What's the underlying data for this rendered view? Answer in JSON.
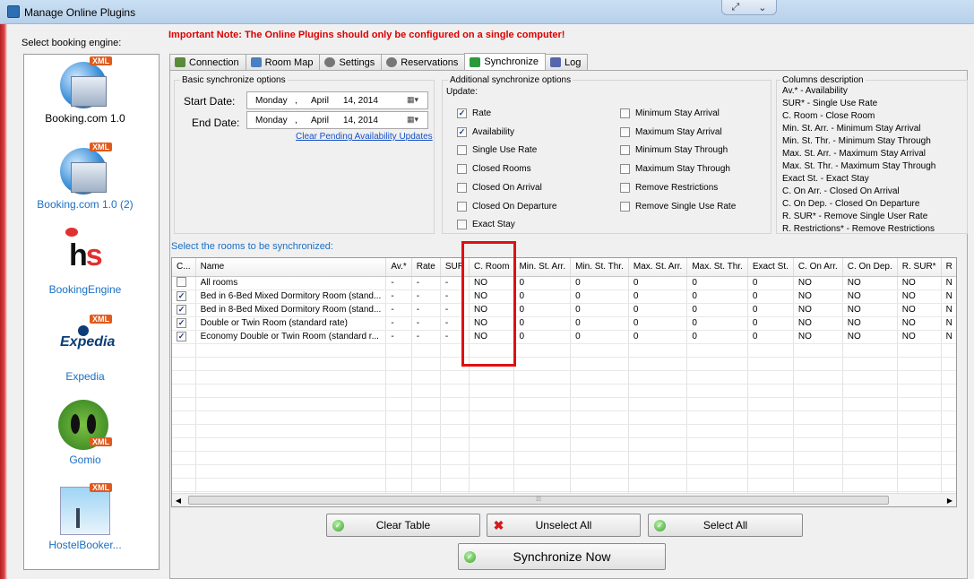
{
  "window": {
    "title": "Manage Online Plugins"
  },
  "left": {
    "select_label": "Select booking engine:",
    "engines": [
      {
        "label": "Booking.com 1.0",
        "icon": "booking-xml-icon",
        "selected": true
      },
      {
        "label": "Booking.com 1.0 (2)",
        "icon": "booking-xml-icon",
        "selected": false
      },
      {
        "label": "BookingEngine",
        "icon": "hs-logo",
        "selected": false
      },
      {
        "label": "Expedia",
        "icon": "expedia-logo",
        "selected": false
      },
      {
        "label": "Gomio",
        "icon": "gomio-logo",
        "selected": false
      },
      {
        "label": "HostelBooker...",
        "icon": "hostelbooker-logo",
        "selected": false
      }
    ],
    "xml_badge": "XML"
  },
  "note": "Important Note: The Online Plugins should only be configured on a single computer!",
  "tabs": [
    {
      "label": "Connection",
      "icon": "connection-icon"
    },
    {
      "label": "Room Map",
      "icon": "room-map-icon"
    },
    {
      "label": "Settings",
      "icon": "gear-icon"
    },
    {
      "label": "Reservations",
      "icon": "gear-icon"
    },
    {
      "label": "Synchronize",
      "icon": "sync-icon",
      "active": true
    },
    {
      "label": "Log",
      "icon": "log-icon"
    }
  ],
  "basic": {
    "title": "Basic synchronize options",
    "start_label": "Start Date:",
    "end_label": "End Date:",
    "start": {
      "weekday": "Monday",
      "month": "April",
      "date": "14, 2014"
    },
    "end": {
      "weekday": "Monday",
      "month": "April",
      "date": "14, 2014"
    },
    "clear_link": "Clear Pending Availability Updates"
  },
  "additional": {
    "title": "Additional synchronize options",
    "update_label": "Update:",
    "col1": [
      {
        "label": "Rate",
        "checked": true
      },
      {
        "label": "Availability",
        "checked": true
      },
      {
        "label": "Single Use Rate",
        "checked": false
      },
      {
        "label": "Closed Rooms",
        "checked": false
      },
      {
        "label": "Closed On Arrival",
        "checked": false
      },
      {
        "label": "Closed On Departure",
        "checked": false
      },
      {
        "label": "Exact Stay",
        "checked": false
      }
    ],
    "col2": [
      {
        "label": "Minimum Stay Arrival",
        "checked": false
      },
      {
        "label": "Maximum Stay Arrival",
        "checked": false
      },
      {
        "label": "Minimum Stay Through",
        "checked": false
      },
      {
        "label": "Maximum Stay Through",
        "checked": false
      },
      {
        "label": "Remove Restrictions",
        "checked": false
      },
      {
        "label": "Remove Single Use Rate",
        "checked": false
      }
    ]
  },
  "columns_desc": {
    "title": "Columns description",
    "lines": [
      "Av.* - Availability",
      "SUR* - Single Use Rate",
      "C. Room - Close Room",
      "Min. St. Arr. - Minimum Stay Arrival",
      "Min. St. Thr. - Minimum Stay Through",
      "Max. St. Arr. - Maximum Stay Arrival",
      "Max. St. Thr. - Maximum Stay Through",
      "Exact St. - Exact Stay",
      "C. On Arr. - Closed On Arrival",
      "C. On Dep. - Closed On Departure",
      "R. SUR* - Remove Single User Rate",
      "R. Restrictions* - Remove Restrictions"
    ]
  },
  "grid": {
    "title": "Select the rooms to be synchronized:",
    "headers": [
      "C...",
      "Name",
      "Av.*",
      "Rate",
      "SUR",
      "C. Room",
      "Min. St. Arr.",
      "Min. St. Thr.",
      "Max. St. Arr.",
      "Max. St. Thr.",
      "Exact St.",
      "C. On Arr.",
      "C. On Dep.",
      "R. SUR*",
      "R"
    ],
    "rows": [
      {
        "checked": false,
        "cells": [
          "All rooms",
          "-",
          "-",
          "-",
          "NO",
          "0",
          "0",
          "0",
          "0",
          "0",
          "NO",
          "NO",
          "NO",
          "N"
        ]
      },
      {
        "checked": true,
        "cells": [
          "Bed in 6-Bed Mixed Dormitory Room (stand...",
          "-",
          "-",
          "-",
          "NO",
          "0",
          "0",
          "0",
          "0",
          "0",
          "NO",
          "NO",
          "NO",
          "N"
        ]
      },
      {
        "checked": true,
        "cells": [
          "Bed in 8-Bed Mixed Dormitory Room (stand...",
          "-",
          "-",
          "-",
          "NO",
          "0",
          "0",
          "0",
          "0",
          "0",
          "NO",
          "NO",
          "NO",
          "N"
        ]
      },
      {
        "checked": true,
        "cells": [
          "Double or Twin Room (standard rate)",
          "-",
          "-",
          "-",
          "NO",
          "0",
          "0",
          "0",
          "0",
          "0",
          "NO",
          "NO",
          "NO",
          "N"
        ]
      },
      {
        "checked": true,
        "cells": [
          "Economy Double or Twin Room (standard r...",
          "-",
          "-",
          "-",
          "NO",
          "0",
          "0",
          "0",
          "0",
          "0",
          "NO",
          "NO",
          "NO",
          "N"
        ]
      }
    ]
  },
  "buttons": {
    "clear": "Clear Table",
    "unselect": "Unselect All",
    "select": "Select All",
    "sync": "Synchronize Now"
  }
}
